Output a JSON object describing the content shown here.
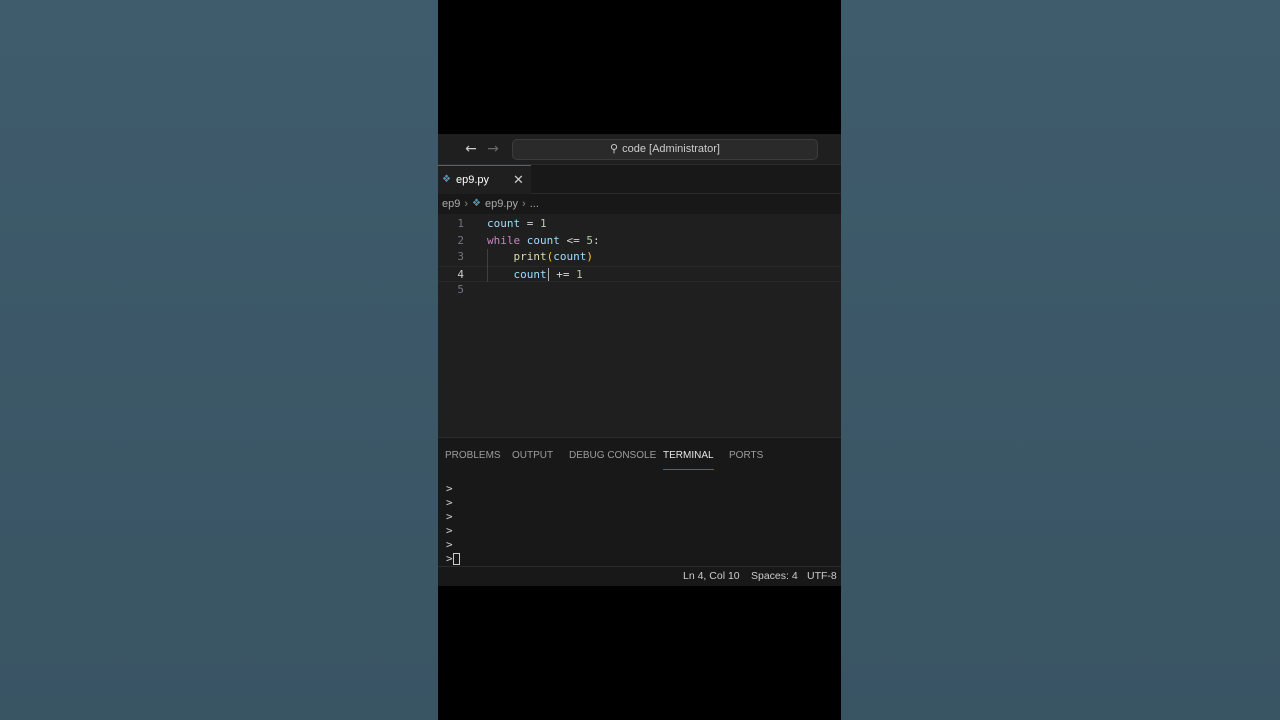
{
  "titlebar": {
    "search_text": "code [Administrator]",
    "back_icon": "arrow-left-icon",
    "forward_icon": "arrow-right-icon",
    "search_icon": "search-icon"
  },
  "tab": {
    "label": "ep9.py",
    "icon": "python-file-icon",
    "close_icon": "close-icon"
  },
  "breadcrumb": {
    "folder": "ep9",
    "file": "ep9.py",
    "more": "..."
  },
  "editor": {
    "line_numbers": [
      "1",
      "2",
      "3",
      "4",
      "5"
    ],
    "active_line": 4,
    "lines": [
      [
        {
          "t": "count",
          "c": "var"
        },
        {
          "t": " = ",
          "c": "op"
        },
        {
          "t": "1",
          "c": "num"
        }
      ],
      [
        {
          "t": "while",
          "c": "ctrl"
        },
        {
          "t": " ",
          "c": "op"
        },
        {
          "t": "count",
          "c": "var"
        },
        {
          "t": " <= ",
          "c": "op"
        },
        {
          "t": "5",
          "c": "num"
        },
        {
          "t": ":",
          "c": "op"
        }
      ],
      [
        {
          "t": "    ",
          "c": "op"
        },
        {
          "t": "print",
          "c": "fn"
        },
        {
          "t": "(",
          "c": "paren"
        },
        {
          "t": "count",
          "c": "var"
        },
        {
          "t": ")",
          "c": "paren"
        }
      ],
      [
        {
          "t": "    ",
          "c": "op"
        },
        {
          "t": "count",
          "c": "var"
        },
        {
          "t": "|cursor|",
          "c": "cursor"
        },
        {
          "t": " += ",
          "c": "op"
        },
        {
          "t": "1",
          "c": "num"
        }
      ],
      []
    ]
  },
  "panel": {
    "tabs": [
      "PROBLEMS",
      "OUTPUT",
      "DEBUG CONSOLE",
      "TERMINAL",
      "PORTS"
    ],
    "active_tab": "TERMINAL",
    "terminal_lines": [
      ">",
      ">",
      ">",
      ">",
      ">",
      ">"
    ]
  },
  "status": {
    "position": "Ln 4, Col 10",
    "spaces": "Spaces: 4",
    "encoding": "UTF-8"
  },
  "colors": {
    "accent": "#0078d4",
    "editor_bg": "#1f1f1f",
    "backdrop": "#3b5666"
  }
}
